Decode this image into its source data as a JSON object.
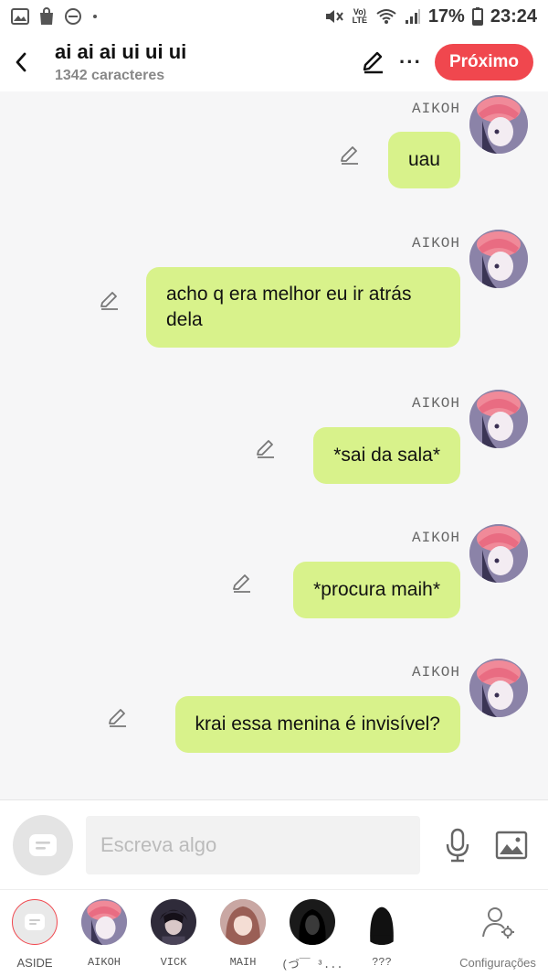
{
  "status_bar": {
    "battery": "17%",
    "time": "23:24",
    "network_label": "Vo) LTE"
  },
  "header": {
    "title": "ai ai ai ui ui ui",
    "subtitle": "1342 caracteres",
    "next_label": "Próximo",
    "more_label": "···"
  },
  "messages": [
    {
      "sender": "AIKOH",
      "text": "uau"
    },
    {
      "sender": "AIKOH",
      "text": "acho q era melhor eu ir atrás dela"
    },
    {
      "sender": "AIKOH",
      "text": "*sai da sala*"
    },
    {
      "sender": "AIKOH",
      "text": "*procura maih*"
    },
    {
      "sender": "AIKOH",
      "text": "krai essa menina é invisível?"
    }
  ],
  "composer": {
    "placeholder": "Escreva algo"
  },
  "characters": [
    {
      "name": "ASIDE"
    },
    {
      "name": "AIKOH"
    },
    {
      "name": "VICK"
    },
    {
      "name": "MAIH"
    },
    {
      "name": "(づ￣ ³..."
    },
    {
      "name": "???"
    },
    {
      "name": "Configurações"
    }
  ],
  "colors": {
    "accent": "#f0474e",
    "bubble": "#d8f28b",
    "background": "#f6f6f7"
  }
}
